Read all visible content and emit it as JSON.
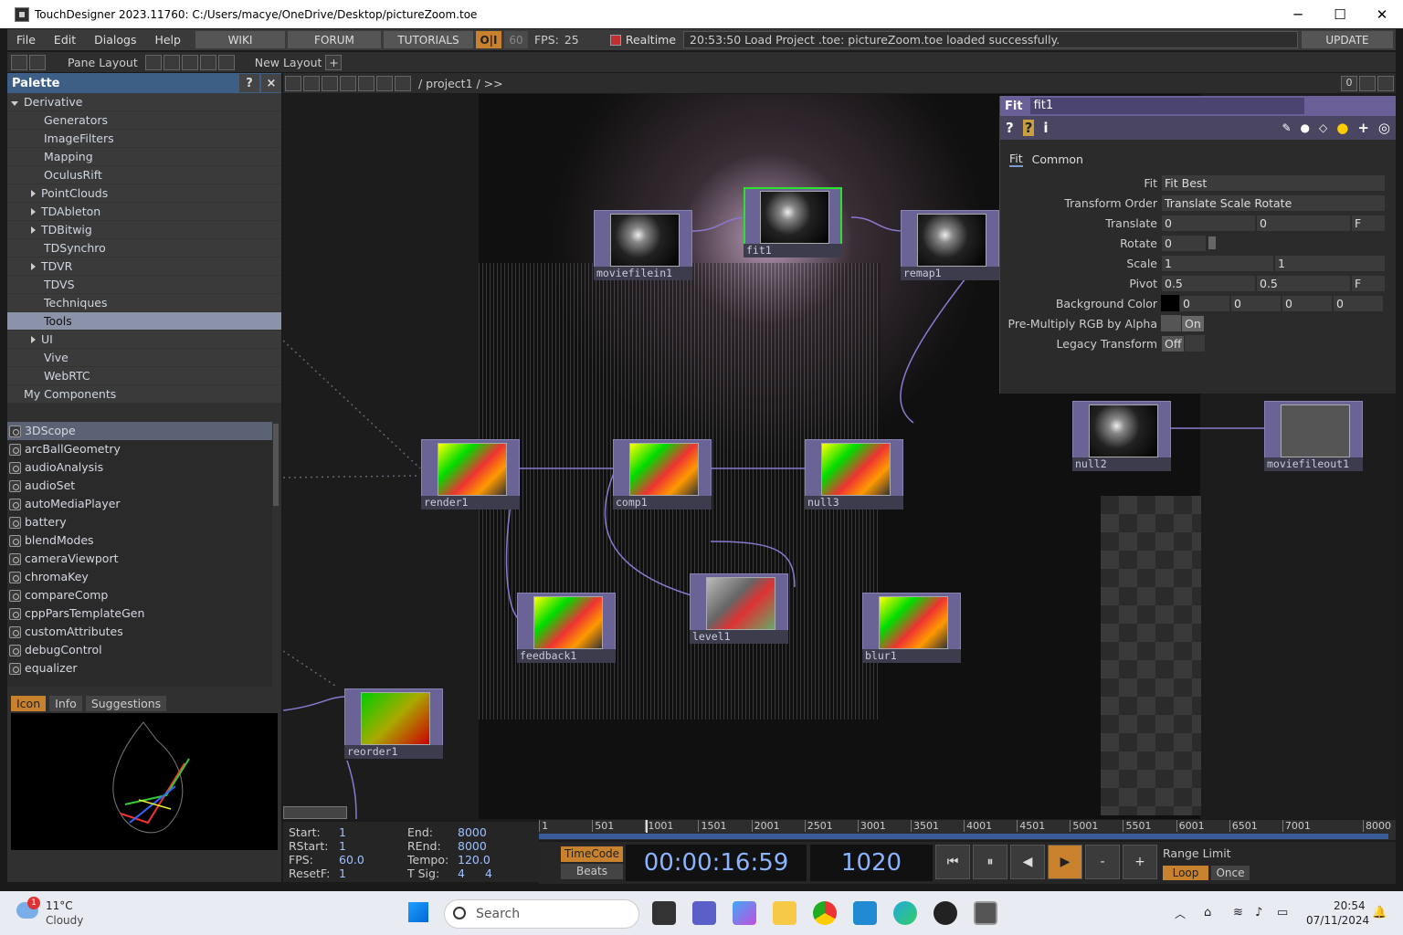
{
  "window": {
    "title": "TouchDesigner 2023.11760: C:/Users/macye/OneDrive/Desktop/pictureZoom.toe"
  },
  "menu": {
    "items": [
      "File",
      "Edit",
      "Dialogs",
      "Help"
    ],
    "wiki": "WIKI",
    "forum": "FORUM",
    "tutorials": "TUTORIALS",
    "oi": "O|I",
    "fps_cap": "60",
    "fps_label": "FPS:",
    "fps_value": "25",
    "realtime": "Realtime",
    "status": "20:53:50 Load Project .toe: pictureZoom.toe loaded successfully.",
    "update": "UPDATE"
  },
  "toolbar": {
    "pane_layout": "Pane Layout",
    "new_layout": "New Layout"
  },
  "palette": {
    "title": "Palette",
    "help": "?",
    "close": "×",
    "tree": [
      {
        "label": "Derivative",
        "level": 0,
        "expand": "open"
      },
      {
        "label": "Generators",
        "level": 1
      },
      {
        "label": "ImageFilters",
        "level": 1
      },
      {
        "label": "Mapping",
        "level": 1
      },
      {
        "label": "OculusRift",
        "level": 1
      },
      {
        "label": "PointClouds",
        "level": 1,
        "expand": "closed"
      },
      {
        "label": "TDAbleton",
        "level": 1,
        "expand": "closed"
      },
      {
        "label": "TDBitwig",
        "level": 1,
        "expand": "closed"
      },
      {
        "label": "TDSynchro",
        "level": 1
      },
      {
        "label": "TDVR",
        "level": 1,
        "expand": "closed"
      },
      {
        "label": "TDVS",
        "level": 1
      },
      {
        "label": "Techniques",
        "level": 1
      },
      {
        "label": "Tools",
        "level": 1,
        "selected": true
      },
      {
        "label": "UI",
        "level": 1,
        "expand": "closed"
      },
      {
        "label": "Vive",
        "level": 1
      },
      {
        "label": "WebRTC",
        "level": 1
      },
      {
        "label": "My Components",
        "level": 0
      }
    ],
    "components": [
      "3DScope",
      "arcBallGeometry",
      "audioAnalysis",
      "audioSet",
      "autoMediaPlayer",
      "battery",
      "blendModes",
      "cameraViewport",
      "chromaKey",
      "compareComp",
      "cppParsTemplateGen",
      "customAttributes",
      "debugControl",
      "equalizer"
    ],
    "tabs": [
      "Icon",
      "Info",
      "Suggestions"
    ]
  },
  "network": {
    "path": "/ project1 / >>",
    "count": "0",
    "nodes": {
      "moviefilein1": "moviefilein1",
      "fit1": "fit1",
      "remap1": "remap1",
      "render1": "render1",
      "comp1": "comp1",
      "null3": "null3",
      "null2": "null2",
      "moviefileout1": "moviefileout1",
      "feedback1": "feedback1",
      "level1": "level1",
      "blur1": "blur1",
      "reorder1": "reorder1"
    }
  },
  "params": {
    "type": "Fit",
    "name": "fit1",
    "tabs": [
      "Fit",
      "Common"
    ],
    "rows": {
      "fit": {
        "label": "Fit",
        "value": "Fit Best"
      },
      "order": {
        "label": "Transform Order",
        "value": "Translate Scale Rotate"
      },
      "translate": {
        "label": "Translate",
        "x": "0",
        "y": "0",
        "unit": "F"
      },
      "rotate": {
        "label": "Rotate",
        "value": "0"
      },
      "scale": {
        "label": "Scale",
        "x": "1",
        "y": "1"
      },
      "pivot": {
        "label": "Pivot",
        "x": "0.5",
        "y": "0.5",
        "unit": "F"
      },
      "bg": {
        "label": "Background Color",
        "r": "0",
        "g": "0",
        "b": "0",
        "a": "0"
      },
      "premult": {
        "label": "Pre-Multiply RGB by Alpha",
        "value": "On"
      },
      "legacy": {
        "label": "Legacy Transform",
        "value": "Off"
      }
    }
  },
  "timeline": {
    "start_k": "Start:",
    "start": "1",
    "end_k": "End:",
    "end": "8000",
    "rstart_k": "RStart:",
    "rstart": "1",
    "rend_k": "REnd:",
    "rend": "8000",
    "fps_k": "FPS:",
    "fps": "60.0",
    "tempo_k": "Tempo:",
    "tempo": "120.0",
    "resetf_k": "ResetF:",
    "resetf": "1",
    "tsig_k": "T Sig:",
    "tsig_a": "4",
    "tsig_b": "4",
    "ticks": [
      "1",
      "501",
      "1001",
      "1501",
      "2001",
      "2501",
      "3001",
      "3501",
      "4001",
      "4501",
      "5001",
      "5501",
      "6001",
      "6501",
      "7001",
      "8000"
    ],
    "timecode_btn": "TimeCode",
    "beats_btn": "Beats",
    "timecode": "00:00:16:59",
    "frame": "1020",
    "range_limit": "Range Limit",
    "loop": "Loop",
    "once": "Once"
  },
  "taskbar": {
    "weather_temp": "11°C",
    "weather_desc": "Cloudy",
    "badge": "1",
    "search": "Search",
    "time": "20:54",
    "date": "07/11/2024"
  }
}
